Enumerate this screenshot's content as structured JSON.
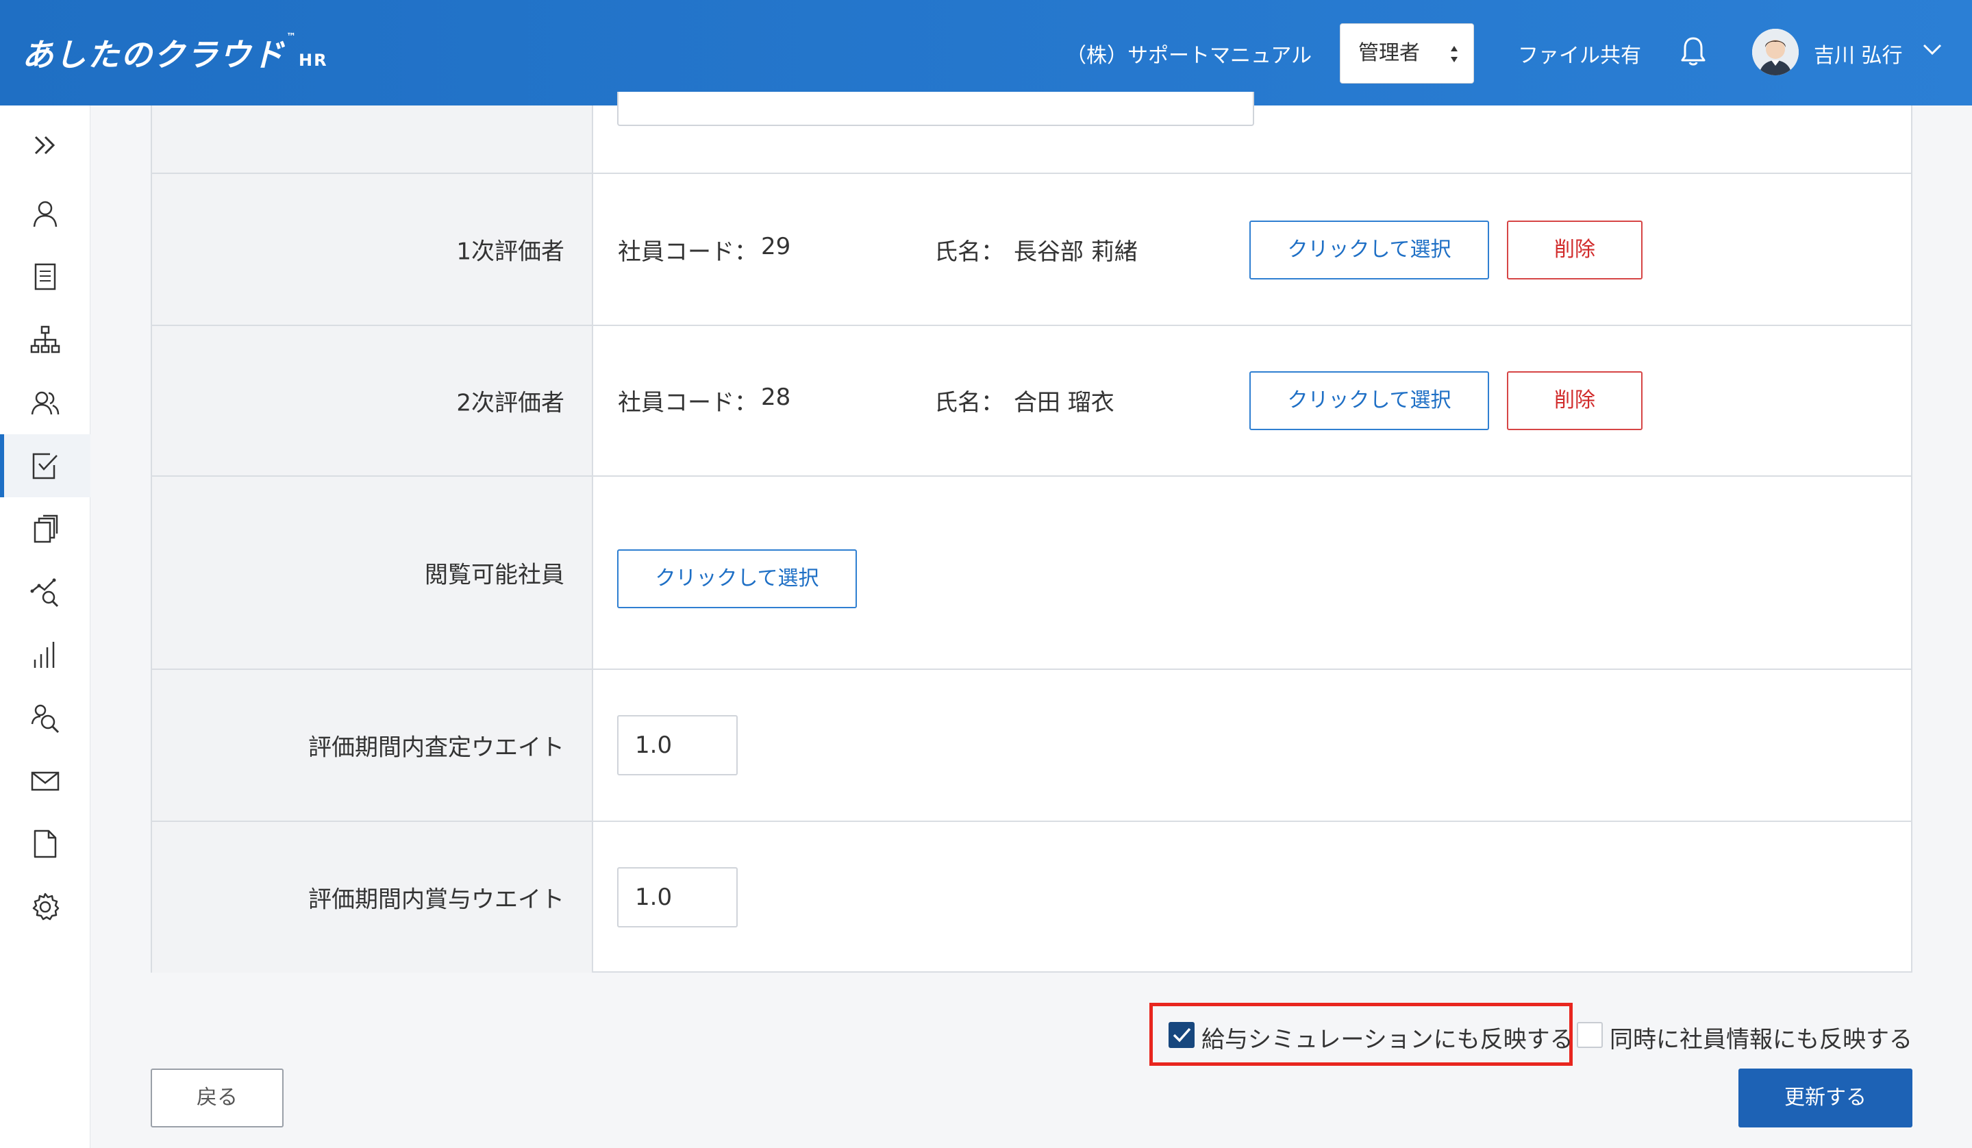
{
  "header": {
    "logo": "あしたのクラウド",
    "logo_tm": "™",
    "logo_suffix": "HR",
    "company": "（株）サポートマニュアル",
    "role": "管理者",
    "file_share": "ファイル共有",
    "user_name": "吉川 弘行"
  },
  "sidebar": {
    "toggle_icon": "double-chevron-right-icon",
    "items": [
      {
        "icon": "person-icon"
      },
      {
        "icon": "document-icon"
      },
      {
        "icon": "org-chart-icon"
      },
      {
        "icon": "people-icon"
      },
      {
        "icon": "checklist-icon",
        "active": true
      },
      {
        "icon": "copy-icon"
      },
      {
        "icon": "analytics-search-icon"
      },
      {
        "icon": "bar-chart-icon"
      },
      {
        "icon": "person-search-icon"
      },
      {
        "icon": "mail-icon"
      },
      {
        "icon": "file-icon"
      },
      {
        "icon": "gear-icon"
      }
    ]
  },
  "form": {
    "evaluator1": {
      "label": "1次評価者",
      "code_label": "社員コード：",
      "code": "29",
      "name_label": "氏名：",
      "name": "長谷部 莉緒",
      "select_label": "クリックして選択",
      "delete_label": "削除"
    },
    "evaluator2": {
      "label": "2次評価者",
      "code_label": "社員コード：",
      "code": "28",
      "name_label": "氏名：",
      "name": "合田 瑠衣",
      "select_label": "クリックして選択",
      "delete_label": "削除"
    },
    "viewers": {
      "label": "閲覧可能社員",
      "select_label": "クリックして選択"
    },
    "assessment_weight": {
      "label": "評価期間内査定ウエイト",
      "value": "1.0"
    },
    "bonus_weight": {
      "label": "評価期間内賞与ウエイト",
      "value": "1.0"
    }
  },
  "actions": {
    "salary_sim_label": "給与シミュレーションにも反映する",
    "salary_sim_checked": true,
    "employee_info_label": "同時に社員情報にも反映する",
    "employee_info_checked": false,
    "back_label": "戻る",
    "update_label": "更新する"
  },
  "colors": {
    "header": "#2b7fd5",
    "accent": "#1e6fc5",
    "delete": "#d12c2c",
    "highlight": "#e8261f",
    "update_button": "#1d62b5"
  }
}
